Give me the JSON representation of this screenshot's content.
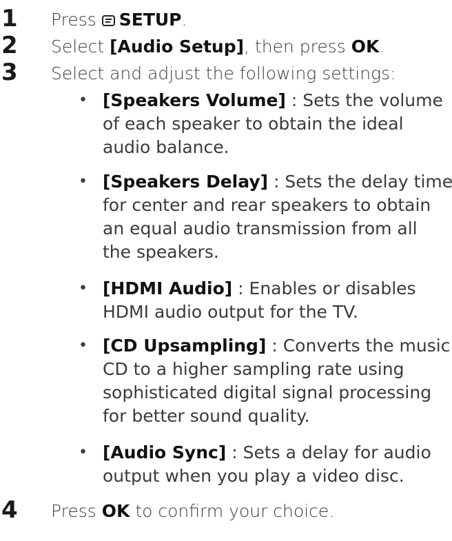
{
  "steps": [
    {
      "number": "1",
      "prefix": "Press",
      "key": "SETUP",
      "suffix": "."
    },
    {
      "number": "2",
      "prefix": "Select",
      "menu": "[Audio Setup]",
      "middle": ", then press",
      "key": "OK",
      "suffix": "."
    },
    {
      "number": "3",
      "text": "Select and adjust the following settings:"
    },
    {
      "number": "4",
      "prefix": "Press",
      "key": "OK",
      "suffix": "to confirm your choice."
    }
  ],
  "settings": [
    {
      "name": "[Speakers Volume]",
      "separator": " : ",
      "lines": [
        "Sets the volume",
        "of each speaker to obtain the ideal",
        "audio balance."
      ]
    },
    {
      "name": "[Speakers Delay]",
      "separator": " : ",
      "lines": [
        "Sets the delay time",
        "for center and rear speakers to obtain",
        "an equal audio transmission from all",
        "the speakers."
      ]
    },
    {
      "name": "[HDMI Audio]",
      "separator": " : ",
      "lines": [
        "Enables or disables",
        "HDMI audio output for the TV."
      ]
    },
    {
      "name": "[CD Upsampling]",
      "separator": " : ",
      "lines": [
        "Converts the music",
        "CD to a higher sampling rate using",
        "sophisticated digital signal processing",
        "for better sound quality."
      ]
    },
    {
      "name": "[Audio Sync]",
      "separator": " : ",
      "lines": [
        "Sets a delay for audio",
        "output when you play a video disc."
      ]
    }
  ],
  "bullet_char": "•",
  "icons": {
    "setup": "setup-menu-icon"
  },
  "colors": {
    "text": "#3a3a3a",
    "emphasis": "#111111",
    "number": "#1a1a1a"
  }
}
